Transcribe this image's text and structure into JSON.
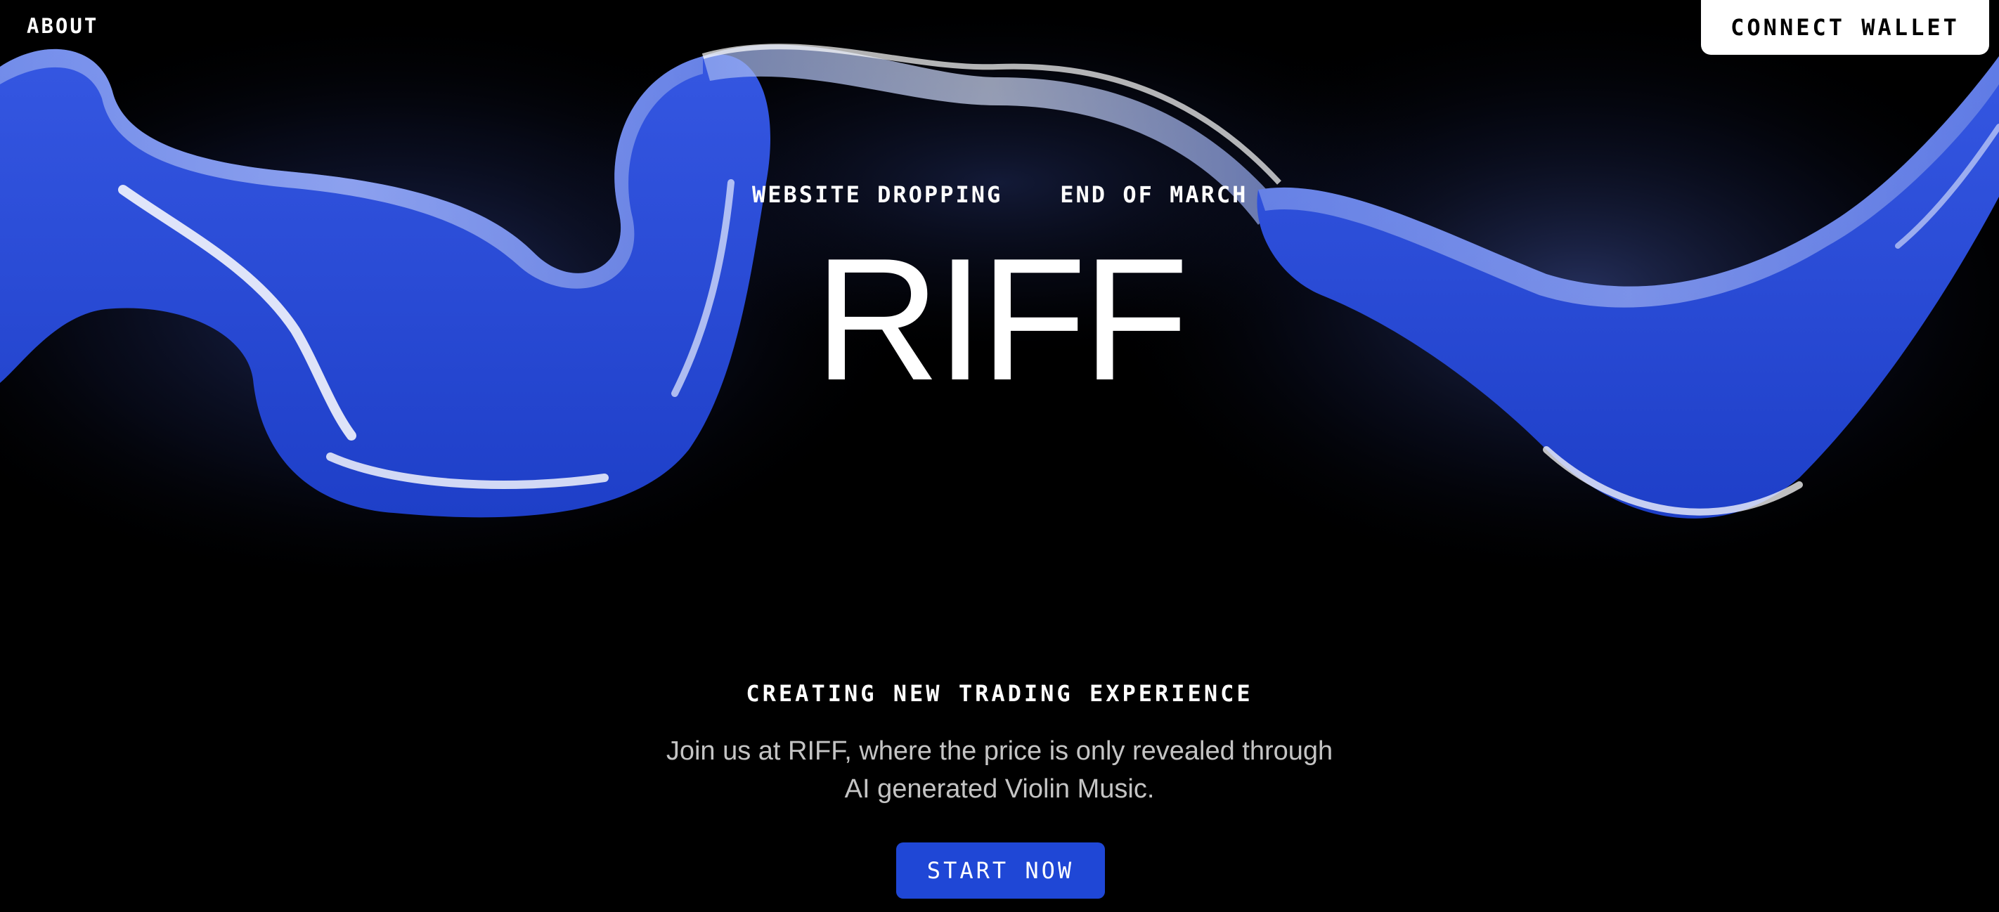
{
  "nav": {
    "about_label": "ABOUT",
    "connect_wallet_label": "CONNECT WALLET"
  },
  "hero": {
    "announcement_left": "WEBSITE DROPPING",
    "announcement_right": "END OF MARCH",
    "brand": "RIFF",
    "tagline": "CREATING NEW TRADING EXPERIENCE",
    "description_line1": "Join us at RIFF, where the price is only revealed through",
    "description_line2": "AI generated Violin Music.",
    "cta_label": "START NOW"
  },
  "colors": {
    "background": "#000000",
    "accent_blue": "#1f47d6",
    "ribbon_blue": "#2446d0",
    "text_white": "#ffffff",
    "text_muted": "#c4c4c4"
  },
  "icons": {
    "hero_image": "glass-ribbon-illustration"
  }
}
